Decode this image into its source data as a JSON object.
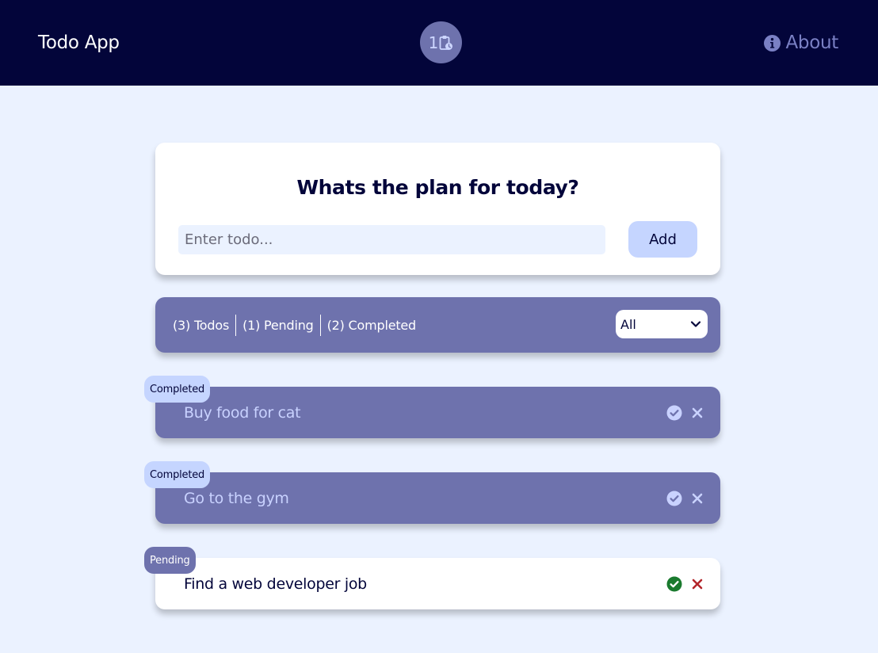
{
  "navbar": {
    "brand": "Todo App",
    "pending_count": "1",
    "about_label": "About"
  },
  "form": {
    "heading": "Whats the plan for today?",
    "input_placeholder": "Enter todo...",
    "input_value": "",
    "add_label": "Add"
  },
  "stats": {
    "total": "(3) Todos",
    "pending": "(1) Pending",
    "completed": "(2) Completed",
    "filter_value": "All"
  },
  "todos": [
    {
      "text": "Buy food for cat",
      "status": "Completed"
    },
    {
      "text": "Go to the gym",
      "status": "Completed"
    },
    {
      "text": "Find a web developer job",
      "status": "Pending"
    }
  ],
  "icons": {
    "navbar_badge": "clipboard-clock-icon",
    "about": "info-circle-icon",
    "filter": "chevron-down-icon",
    "complete": "check-circle-icon",
    "delete": "close-icon"
  },
  "colors": {
    "navbar_bg": "#03053a",
    "page_bg": "#ebf2ff",
    "accent": "#6e72ad",
    "light_accent": "#c5d5ff",
    "check_pending": "#1a7a2e",
    "delete_pending": "#b3262b"
  }
}
